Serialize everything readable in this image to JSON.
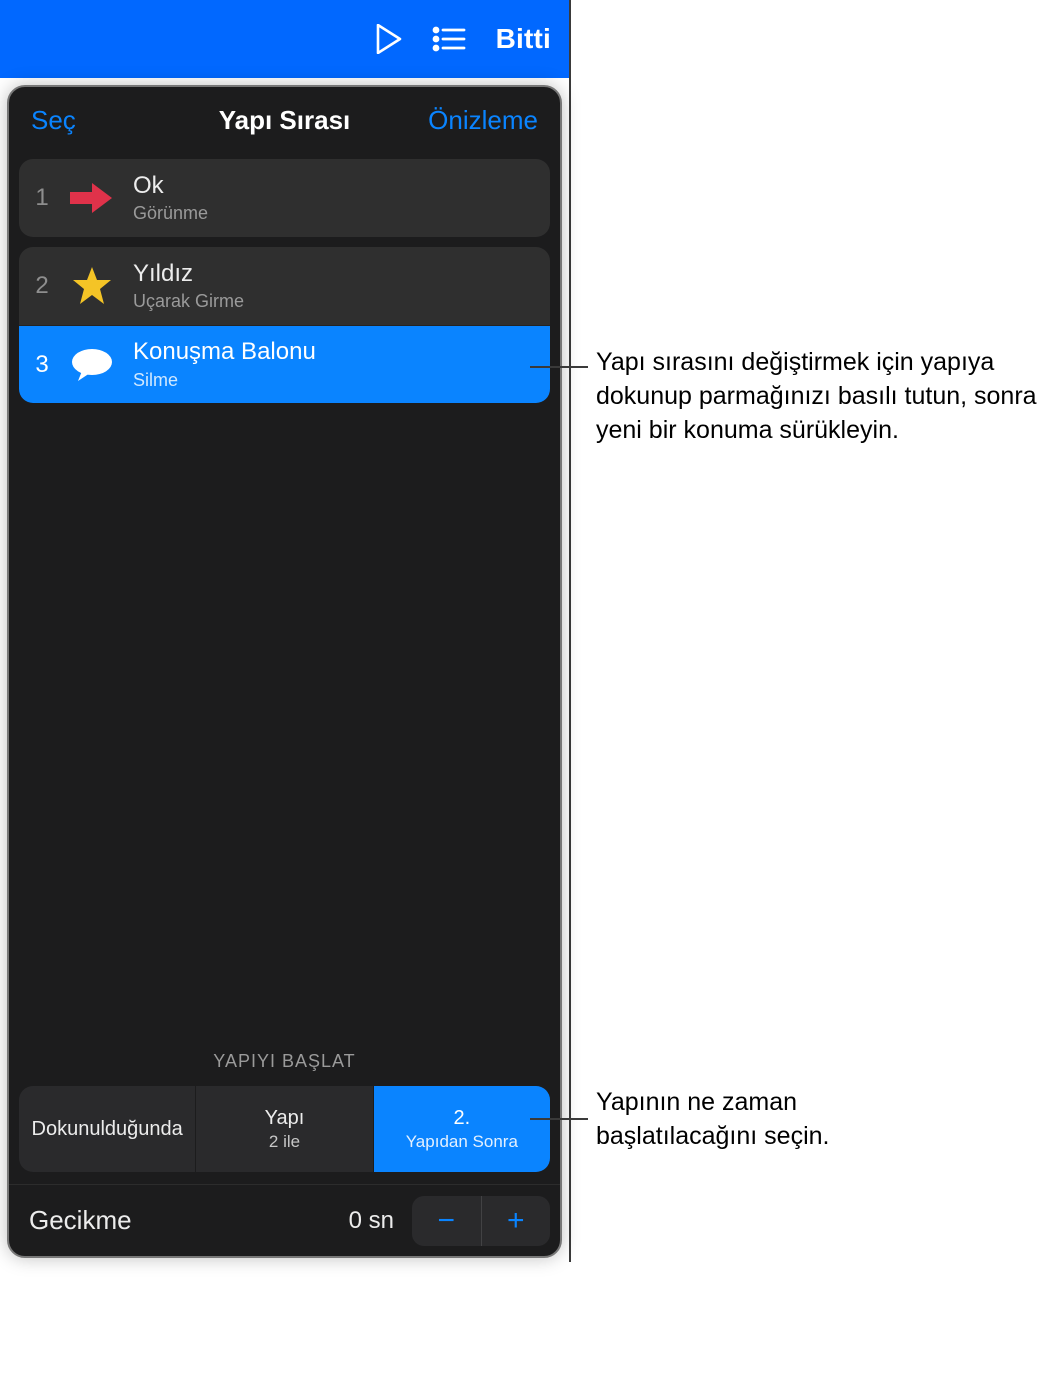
{
  "navbar": {
    "done_label": "Bitti"
  },
  "popover": {
    "select_label": "Seç",
    "title": "Yapı Sırası",
    "preview_label": "Önizleme"
  },
  "builds": [
    {
      "num": "1",
      "title": "Ok",
      "effect": "Görünme",
      "icon": "arrow",
      "selected": false
    },
    {
      "num": "2",
      "title": "Yıldız",
      "effect": "Uçarak Girme",
      "icon": "star",
      "selected": false
    },
    {
      "num": "3",
      "title": "Konuşma Balonu",
      "effect": "Silme",
      "icon": "speech",
      "selected": true
    }
  ],
  "start": {
    "section_label": "YAPIYI BAŞLAT",
    "options": [
      {
        "line1": "Dokunulduğunda",
        "line2": "",
        "active": false
      },
      {
        "line1": "Yapı",
        "line2": "2 ile",
        "active": false
      },
      {
        "line1": "2.",
        "line2": "Yapıdan Sonra",
        "active": true
      }
    ]
  },
  "delay": {
    "label": "Gecikme",
    "value": "0 sn"
  },
  "callouts": {
    "c1": "Yapı sırasını değiştirmek için yapıya dokunup parmağınızı basılı tutun, sonra yeni bir konuma sürükleyin.",
    "c2": "Yapının ne zaman başlatılacağını seçin."
  }
}
